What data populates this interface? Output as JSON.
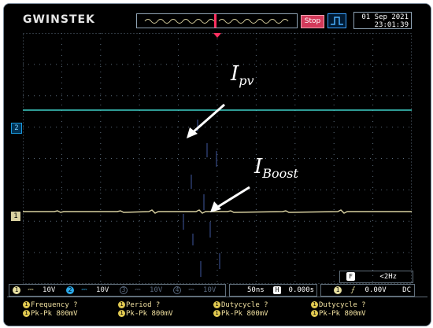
{
  "header": {
    "brand": "GWINSTEK",
    "run_status": "Stop",
    "date": "01 Sep 2021",
    "time": "23:01:39"
  },
  "annotations": {
    "ipv_main": "I",
    "ipv_sub": "pv",
    "iboost_main": "I",
    "iboost_sub": "Boost"
  },
  "channels": [
    {
      "num": "1",
      "scale": "10V",
      "color": "#e8e0a0"
    },
    {
      "num": "2",
      "scale": "10V",
      "color": "#2aa8e8"
    },
    {
      "num": "3",
      "scale": "10V",
      "color": "#5a6a80"
    },
    {
      "num": "4",
      "scale": "10V",
      "color": "#5a6a80"
    }
  ],
  "markers": {
    "ch1": "1",
    "ch2": "2"
  },
  "timebase": {
    "scale": "50ns",
    "h_label": "H",
    "position": "0.000s"
  },
  "trigger": {
    "source": "1",
    "level": "0.00V",
    "coupling": "DC"
  },
  "freq_counter": {
    "label": "F",
    "value": "<2Hz"
  },
  "measurements": [
    {
      "num": "1",
      "name": "Frequency ?",
      "value": "Pk-Pk 800mV"
    },
    {
      "num": "1",
      "name": "Period ?",
      "value": "Pk-Pk 800mV"
    },
    {
      "num": "1",
      "name": "Dutycycle ?",
      "value": "Pk-Pk 800mV"
    },
    {
      "num": "1",
      "name": "Dutycycle ?",
      "value": "Pk-Pk 800mV"
    }
  ],
  "colors": {
    "ch1_trace": "#d8d0a0",
    "ch2_trace": "#3fd0c8",
    "grid": "#5a6a7a",
    "stop_badge": "#d33a5a"
  }
}
